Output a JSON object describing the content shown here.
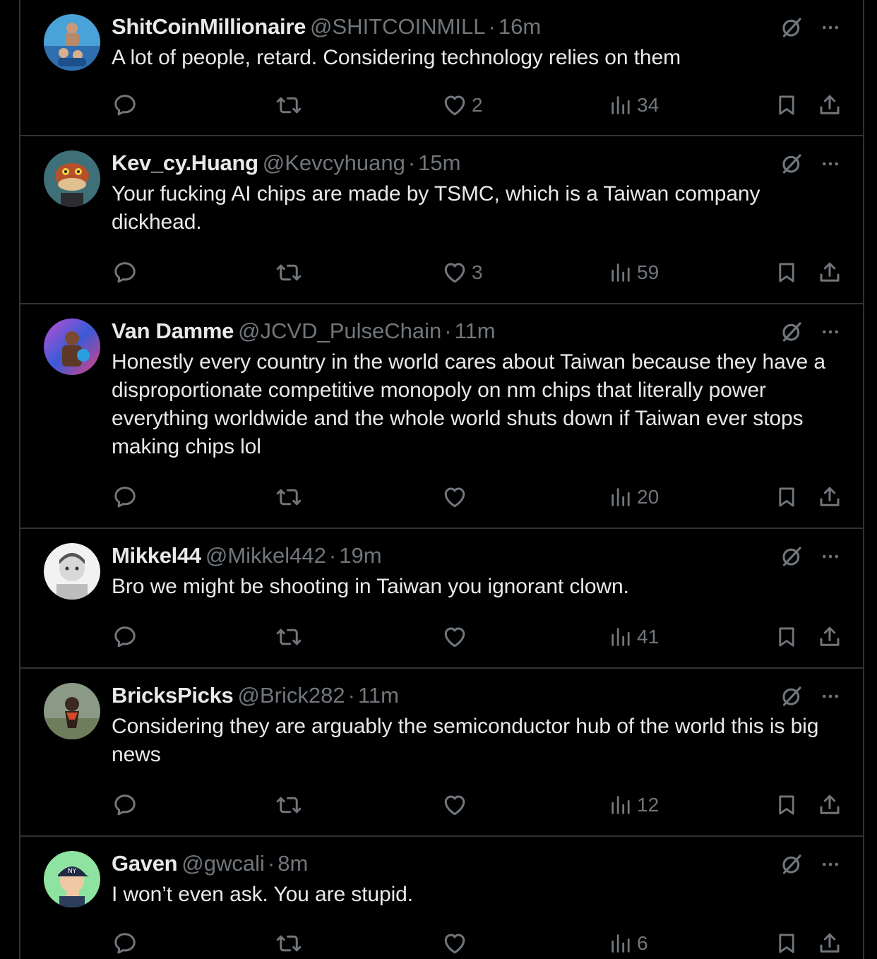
{
  "colors": {
    "background": "#000000",
    "text_primary": "#e7e9ea",
    "text_secondary": "#71767b",
    "divider": "#2f3336"
  },
  "icons": [
    "speech-bubble-icon",
    "repost-icon",
    "heart-icon",
    "views-chart-icon",
    "bookmark-icon",
    "share-icon",
    "grok-slash-circle-icon",
    "more-dots-icon"
  ],
  "replies": [
    {
      "display_name": "ShitCoinMillionaire",
      "handle": "@SHITCOINMILL",
      "separator": "·",
      "time": "16m",
      "text": "A lot of people, retard. Considering technology relies on them",
      "likes": "2",
      "views": "34"
    },
    {
      "display_name": "Kev_cy.Huang",
      "handle": "@Kevcyhuang",
      "separator": "·",
      "time": "15m",
      "text": "Your fucking AI chips are made by TSMC, which is a Taiwan company dickhead.",
      "likes": "3",
      "views": "59"
    },
    {
      "display_name": "Van Damme",
      "handle": "@JCVD_PulseChain",
      "separator": "·",
      "time": "11m",
      "text": "Honestly every country in the world cares about Taiwan because they have a disproportionate competitive monopoly on nm chips that literally power everything worldwide and the whole world shuts down if Taiwan ever stops making chips lol",
      "likes": "",
      "views": "20"
    },
    {
      "display_name": "Mikkel44",
      "handle": "@Mikkel442",
      "separator": "·",
      "time": "19m",
      "text": "Bro we might be shooting in Taiwan you ignorant clown.",
      "likes": "",
      "views": "41"
    },
    {
      "display_name": "BricksPicks",
      "handle": "@Brick282",
      "separator": "·",
      "time": "11m",
      "text": "Considering they are arguably the semiconductor hub of the world this is big news",
      "likes": "",
      "views": "12"
    },
    {
      "display_name": "Gaven",
      "handle": "@gwcali",
      "separator": "·",
      "time": "8m",
      "text": "I won’t even ask. You are stupid.",
      "likes": "",
      "views": "6"
    }
  ]
}
